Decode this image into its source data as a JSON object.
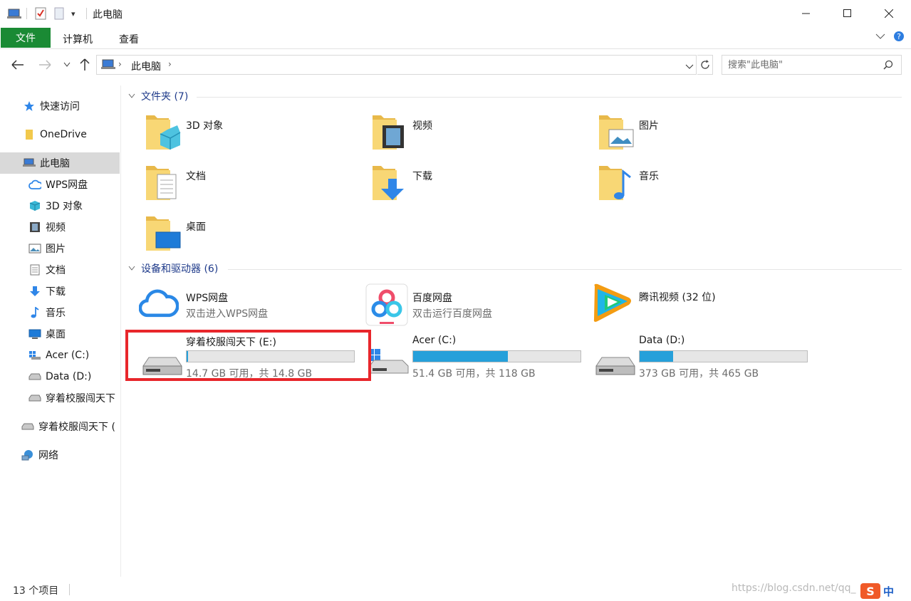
{
  "window": {
    "title": "此电脑",
    "quick_access_dropdown": "▾"
  },
  "ribbon": {
    "tabs": [
      "文件",
      "计算机",
      "查看"
    ]
  },
  "address": {
    "location": "此电脑",
    "search_placeholder": "搜索\"此电脑\""
  },
  "sidebar": {
    "items": [
      {
        "label": "快速访问",
        "icon": "star-icon"
      },
      {
        "label": "OneDrive",
        "icon": "folder-icon"
      },
      {
        "label": "此电脑",
        "icon": "computer-icon",
        "selected": true
      },
      {
        "label": "WPS网盘",
        "icon": "cloud-icon"
      },
      {
        "label": "3D 对象",
        "icon": "cube-icon"
      },
      {
        "label": "视频",
        "icon": "film-icon"
      },
      {
        "label": "图片",
        "icon": "picture-icon"
      },
      {
        "label": "文档",
        "icon": "document-icon"
      },
      {
        "label": "下载",
        "icon": "download-arrow-icon"
      },
      {
        "label": "音乐",
        "icon": "music-note-icon"
      },
      {
        "label": "桌面",
        "icon": "desktop-icon"
      },
      {
        "label": "Acer (C:)",
        "icon": "windows-drive-icon"
      },
      {
        "label": "Data (D:)",
        "icon": "drive-icon"
      },
      {
        "label": "穿着校服闯天下",
        "icon": "drive-icon"
      },
      {
        "label": "穿着校服闯天下 (",
        "icon": "drive-icon"
      },
      {
        "label": "网络",
        "icon": "network-icon"
      }
    ]
  },
  "folders": {
    "heading": "文件夹 (7)",
    "items": [
      {
        "label": "3D 对象",
        "icon": "cube-folder-icon"
      },
      {
        "label": "视频",
        "icon": "video-folder-icon"
      },
      {
        "label": "图片",
        "icon": "pictures-folder-icon"
      },
      {
        "label": "文档",
        "icon": "documents-folder-icon"
      },
      {
        "label": "下载",
        "icon": "downloads-folder-icon"
      },
      {
        "label": "音乐",
        "icon": "music-folder-icon"
      },
      {
        "label": "桌面",
        "icon": "desktop-folder-icon"
      }
    ]
  },
  "devices": {
    "heading": "设备和驱动器 (6)",
    "apps": [
      {
        "label": "WPS网盘",
        "sub": "双击进入WPS网盘",
        "icon": "wps-cloud-icon"
      },
      {
        "label": "百度网盘",
        "sub": "双击运行百度网盘",
        "icon": "baidu-netdisk-icon"
      },
      {
        "label": "腾讯视频 (32 位)",
        "sub": "",
        "icon": "tencent-video-icon"
      }
    ],
    "drives": [
      {
        "name": "穿着校服闯天下 (E:)",
        "free": "14.7 GB 可用，共 14.8 GB",
        "used_fraction": 0.007,
        "icon": "usb-drive-icon"
      },
      {
        "name": "Acer (C:)",
        "free": "51.4 GB 可用，共 118 GB",
        "used_fraction": 0.564,
        "icon": "windows-drive-icon"
      },
      {
        "name": "Data (D:)",
        "free": "373 GB 可用，共 465 GB",
        "used_fraction": 0.198,
        "icon": "drive-icon"
      }
    ]
  },
  "status": {
    "count": "13 个项目",
    "watermark": "https://blog.csdn.net/qq_",
    "ime": "中"
  },
  "colors": {
    "file_tab": "#1a8a34",
    "drive_fill": "#26a0da",
    "highlight": "#e8262b",
    "group_heading": "#1e3a8a"
  }
}
